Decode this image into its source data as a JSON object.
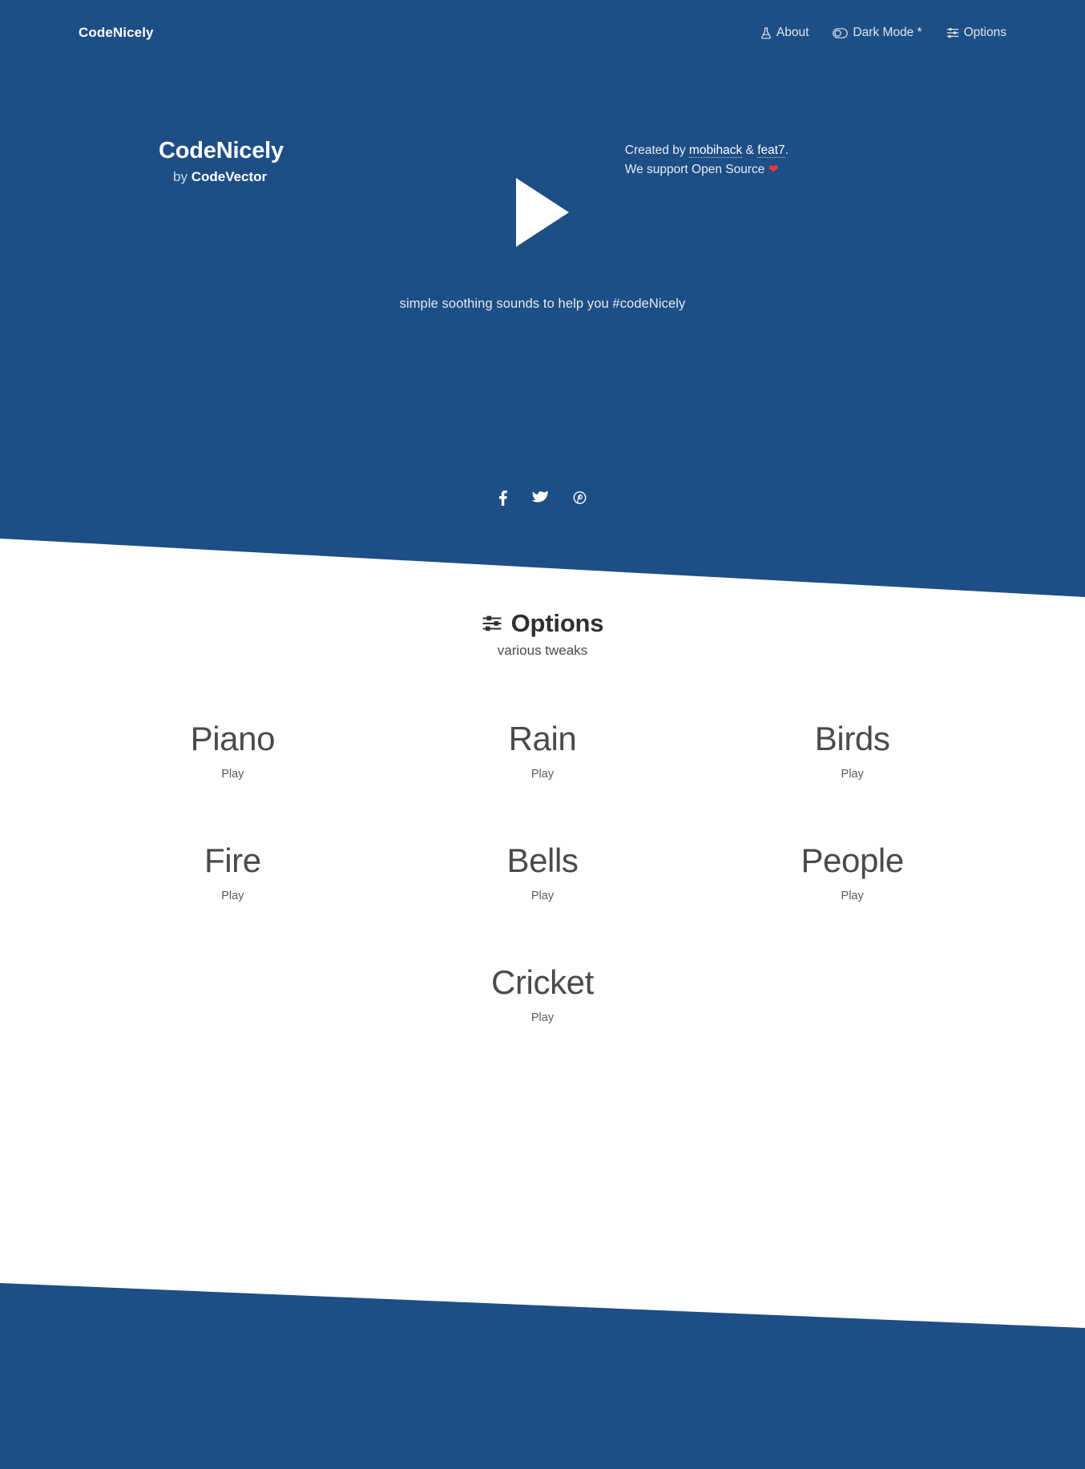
{
  "theme": {
    "brand_blue": "#1d4e85",
    "page_bg": "#ffffff",
    "heading_color": "#2f2f2f",
    "heart_color": "#e8383d"
  },
  "header": {
    "brand": "CodeNicely",
    "nav": [
      {
        "label": "About",
        "icon": "flask-icon"
      },
      {
        "label": "Dark Mode *",
        "icon": "toggle-icon"
      },
      {
        "label": "Options",
        "icon": "sliders-icon"
      }
    ]
  },
  "hero": {
    "play_icon": "play-triangle-icon",
    "tagline": "simple soothing sounds to help you #codeNicely",
    "socials": [
      {
        "name": "facebook-icon",
        "label": "Facebook"
      },
      {
        "name": "twitter-icon",
        "label": "Twitter"
      },
      {
        "name": "pinterest-icon",
        "label": "Pinterest"
      }
    ]
  },
  "options": {
    "icon": "sliders-icon",
    "title": "Options",
    "subtitle": "various tweaks",
    "cards": [
      {
        "title": "Piano",
        "status": "Play",
        "icon": "play-circle-icon"
      },
      {
        "title": "Rain",
        "status": "Play",
        "icon": "play-circle-icon"
      },
      {
        "title": "Birds",
        "status": "Play",
        "icon": "play-circle-icon"
      },
      {
        "title": "Fire",
        "status": "Play",
        "icon": "play-circle-icon"
      },
      {
        "title": "Bells",
        "status": "Play",
        "icon": "play-circle-icon"
      },
      {
        "title": "People",
        "status": "Play",
        "icon": "play-circle-icon"
      },
      {
        "title": "Cricket",
        "status": "Play",
        "icon": "play-circle-icon"
      }
    ]
  },
  "footer": {
    "brand": "CodeNicely",
    "by_prefix": "by ",
    "by_name": "CodeVector",
    "credit_prefix": "Created by ",
    "credit_author_1": "mobihack",
    "credit_amp": " & ",
    "credit_author_2": "feat7",
    "credit_suffix": ".",
    "support_text": "We support Open Source ",
    "support_heart": "❤"
  }
}
